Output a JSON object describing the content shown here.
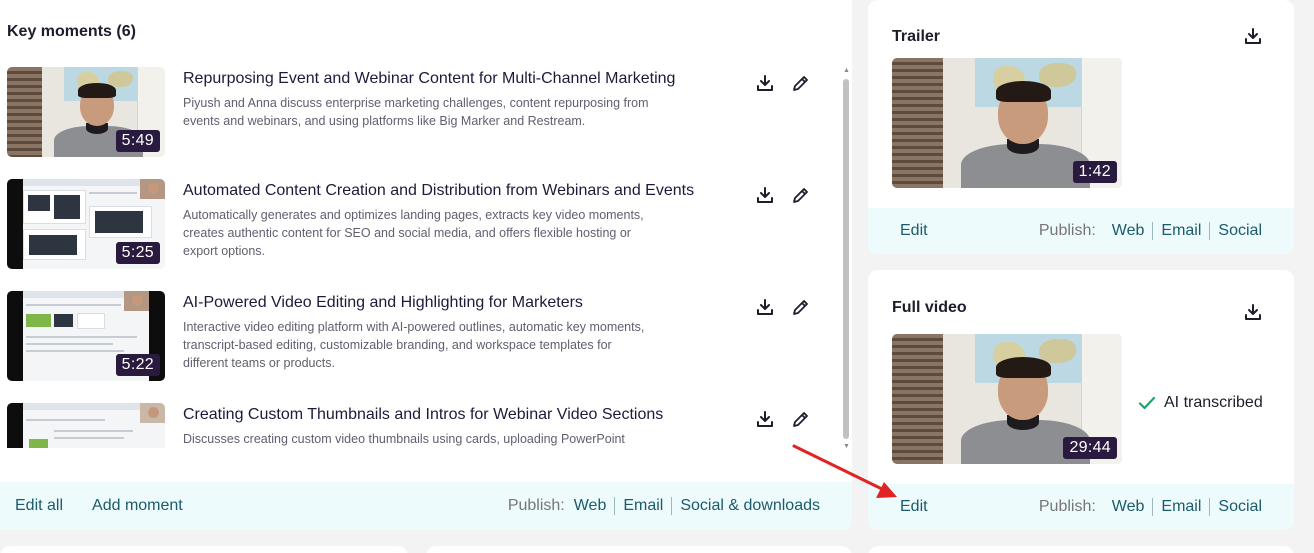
{
  "moments": {
    "title": "Key moments (6)",
    "items": [
      {
        "title": "Repurposing Event and Webinar Content for Multi-Channel Marketing",
        "description": "Piyush and Anna discuss enterprise marketing challenges, content repurposing from events and webinars, and using platforms like Big Marker and Restream.",
        "duration": "5:49"
      },
      {
        "title": "Automated Content Creation and Distribution from Webinars and Events",
        "description": "Automatically generates and optimizes landing pages, extracts key video moments, creates authentic content for SEO and social media, and offers flexible hosting or export options.",
        "duration": "5:25"
      },
      {
        "title": "AI-Powered Video Editing and Highlighting for Marketers",
        "description": "Interactive video editing platform with AI-powered outlines, automatic key moments, transcript-based editing, customizable branding, and workspace templates for different teams or products.",
        "duration": "5:22"
      },
      {
        "title": "Creating Custom Thumbnails and Intros for Webinar Video Sections",
        "description": "Discusses creating custom video thumbnails using cards, uploading PowerPoint slides, and dynamically applying styles for efficient workflows.",
        "duration": ""
      }
    ],
    "footer": {
      "edit_all": "Edit all",
      "add_moment": "Add moment",
      "publish_label": "Publish:",
      "web": "Web",
      "email": "Email",
      "social": "Social & downloads"
    }
  },
  "trailer": {
    "title": "Trailer",
    "duration": "1:42",
    "footer": {
      "edit": "Edit",
      "publish_label": "Publish:",
      "web": "Web",
      "email": "Email",
      "social": "Social"
    }
  },
  "full_video": {
    "title": "Full video",
    "duration": "29:44",
    "status": "AI transcribed",
    "footer": {
      "edit": "Edit",
      "publish_label": "Publish:",
      "web": "Web",
      "email": "Email",
      "social": "Social"
    }
  },
  "icons": {
    "download": "download-icon",
    "edit": "pencil-icon",
    "check": "checkmark-icon"
  },
  "colors": {
    "accent_link": "#1b5b6b",
    "footer_bg": "#eefbfc",
    "duration_badge": "#2b1a3f",
    "check": "#22a06b",
    "annotation_arrow": "#e02424"
  }
}
